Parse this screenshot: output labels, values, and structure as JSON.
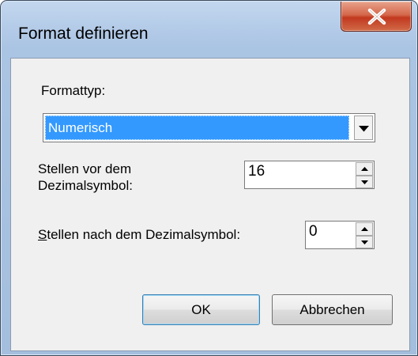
{
  "window": {
    "title": "Format definieren"
  },
  "form": {
    "format_type_label": "Formattyp:",
    "format_type_value": "Numerisch",
    "digits_before_label_line1": "Stellen vor dem",
    "digits_before_label_line2": "Dezimalsymbol:",
    "digits_before_value": "16",
    "digits_after_label_mnemonic": "S",
    "digits_after_label_rest": "tellen nach dem Dezimalsymbol:",
    "digits_after_value": "0"
  },
  "buttons": {
    "ok_label": "OK",
    "cancel_label": "Abbrechen"
  },
  "icons": {
    "close": "close-icon",
    "dropdown": "chevron-down-icon",
    "spin_up": "arrow-up-icon",
    "spin_down": "arrow-down-icon"
  },
  "colors": {
    "selection": "#3399ff",
    "close_button": "#c8412a",
    "titlebar": "#b6cde9",
    "client": "#f0f0f0"
  }
}
